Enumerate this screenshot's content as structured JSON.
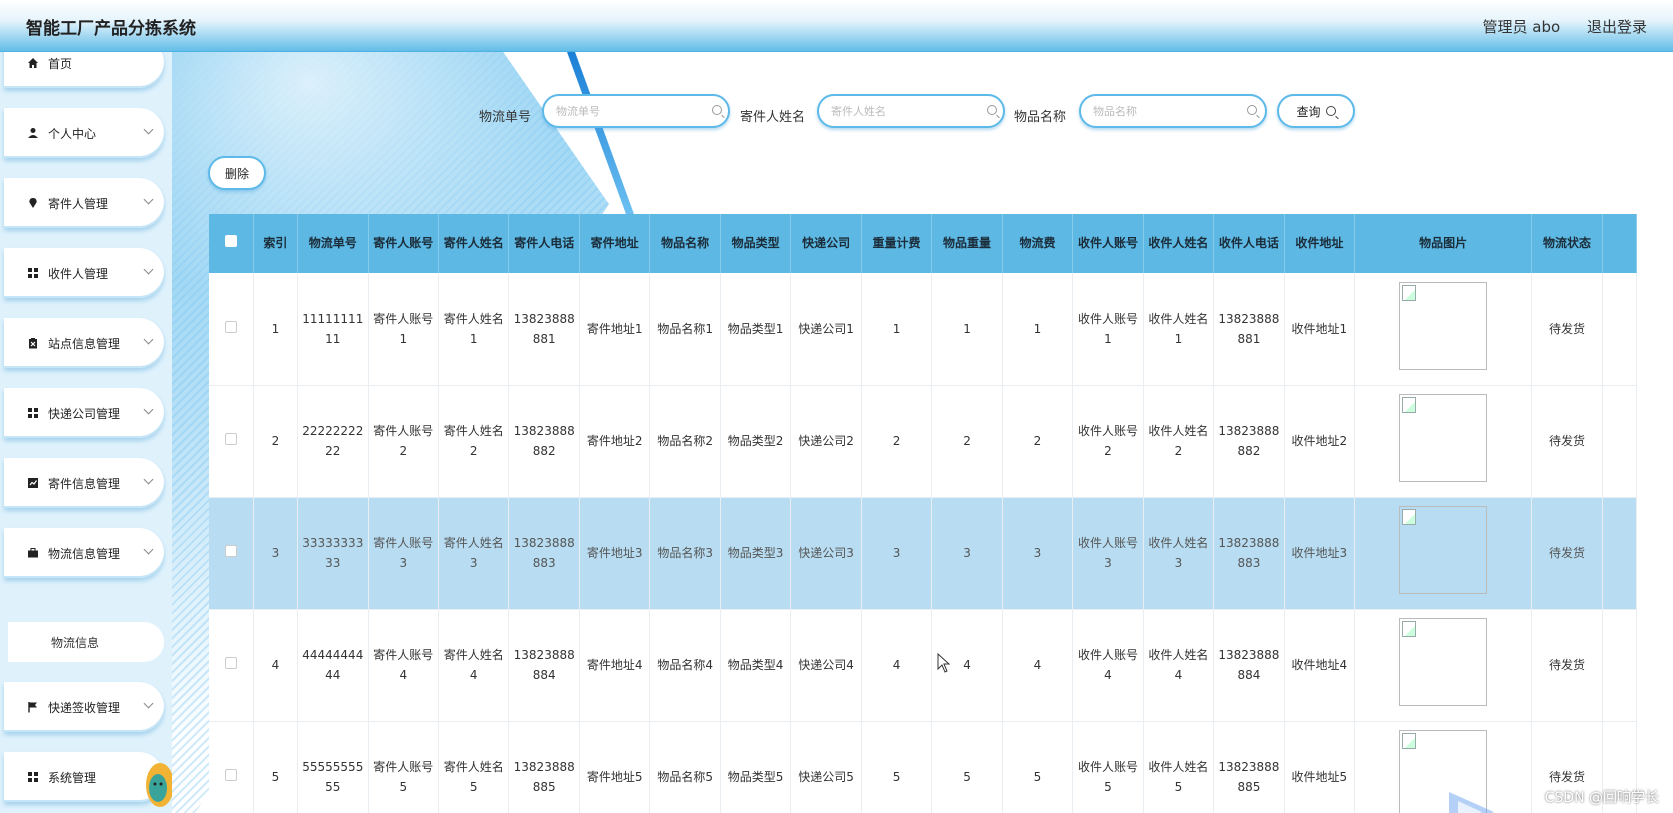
{
  "header": {
    "title": "智能工厂产品分拣系统",
    "user": "管理员 abo",
    "logout": "退出登录"
  },
  "sidebar": {
    "items": [
      {
        "label": "首页",
        "icon": "home-icon"
      },
      {
        "label": "个人中心",
        "icon": "user-icon"
      },
      {
        "label": "寄件人管理",
        "icon": "pin-icon"
      },
      {
        "label": "收件人管理",
        "icon": "grid-icon"
      },
      {
        "label": "站点信息管理",
        "icon": "clipboard-icon"
      },
      {
        "label": "快递公司管理",
        "icon": "grid-icon"
      },
      {
        "label": "寄件信息管理",
        "icon": "chart-icon"
      },
      {
        "label": "物流信息管理",
        "icon": "briefcase-icon"
      },
      {
        "label": "快递签收管理",
        "icon": "flag-icon"
      },
      {
        "label": "系统管理",
        "icon": "grid-icon"
      }
    ],
    "sub_item": "物流信息"
  },
  "search": {
    "field1_label": "物流单号",
    "field1_placeholder": "物流单号",
    "field2_label": "寄件人姓名",
    "field2_placeholder": "寄件人姓名",
    "field3_label": "物品名称",
    "field3_placeholder": "物品名称",
    "query_button": "查询"
  },
  "toolbar": {
    "delete_button": "删除"
  },
  "table": {
    "headers": [
      "索引",
      "物流单号",
      "寄件人账号",
      "寄件人姓名",
      "寄件人电话",
      "寄件地址",
      "物品名称",
      "物品类型",
      "快递公司",
      "重量计费",
      "物品重量",
      "物流费",
      "收件人账号",
      "收件人姓名",
      "收件人电话",
      "收件地址",
      "物品图片",
      "物流状态"
    ],
    "rows": [
      [
        "1",
        "1111111111",
        "寄件人账号1",
        "寄件人姓名1",
        "13823888881",
        "寄件地址1",
        "物品名称1",
        "物品类型1",
        "快递公司1",
        "1",
        "1",
        "1",
        "收件人账号1",
        "收件人姓名1",
        "13823888881",
        "收件地址1",
        "",
        "待发货"
      ],
      [
        "2",
        "2222222222",
        "寄件人账号2",
        "寄件人姓名2",
        "13823888882",
        "寄件地址2",
        "物品名称2",
        "物品类型2",
        "快递公司2",
        "2",
        "2",
        "2",
        "收件人账号2",
        "收件人姓名2",
        "13823888882",
        "收件地址2",
        "",
        "待发货"
      ],
      [
        "3",
        "3333333333",
        "寄件人账号3",
        "寄件人姓名3",
        "13823888883",
        "寄件地址3",
        "物品名称3",
        "物品类型3",
        "快递公司3",
        "3",
        "3",
        "3",
        "收件人账号3",
        "收件人姓名3",
        "13823888883",
        "收件地址3",
        "",
        "待发货"
      ],
      [
        "4",
        "4444444444",
        "寄件人账号4",
        "寄件人姓名4",
        "13823888884",
        "寄件地址4",
        "物品名称4",
        "物品类型4",
        "快递公司4",
        "4",
        "4",
        "4",
        "收件人账号4",
        "收件人姓名4",
        "13823888884",
        "收件地址4",
        "",
        "待发货"
      ],
      [
        "5",
        "5555555555",
        "寄件人账号5",
        "寄件人姓名5",
        "13823888885",
        "寄件地址5",
        "物品名称5",
        "物品类型5",
        "快递公司5",
        "5",
        "5",
        "5",
        "收件人账号5",
        "收件人姓名5",
        "13823888885",
        "收件地址5",
        "",
        "待发货"
      ]
    ],
    "highlighted_row": 2
  },
  "watermark": "CSDN @回响学长",
  "colors": {
    "header_blue": "#5db9e3",
    "accent": "#5db9e8",
    "highlight_row": "#b8ddf2"
  }
}
